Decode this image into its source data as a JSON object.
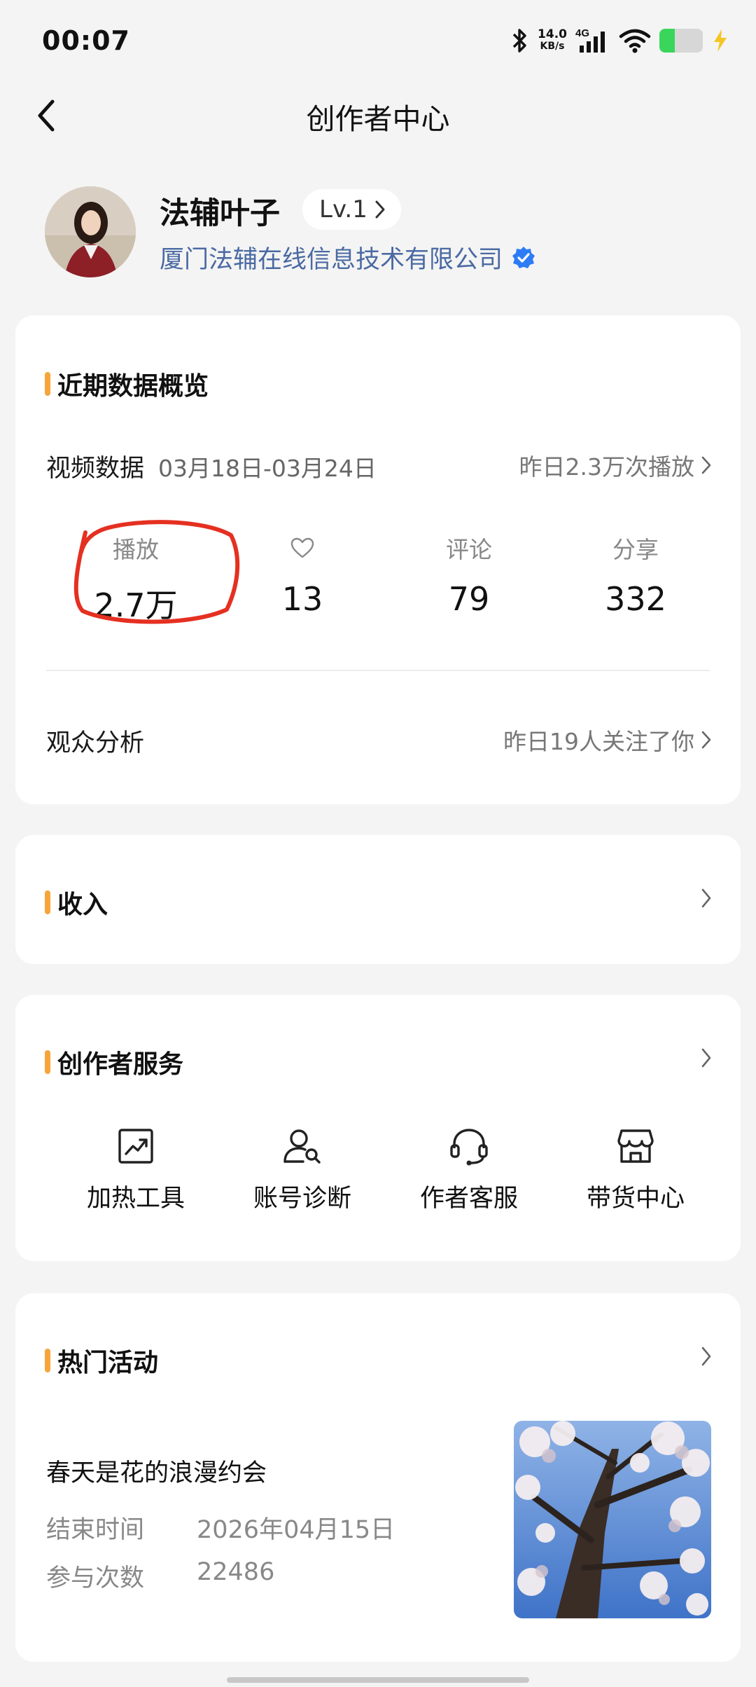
{
  "status_bar": {
    "time": "00:07",
    "net_speed_value": "14.0",
    "net_speed_unit": "KB/s",
    "network": "4G",
    "battery_fraction": 0.35,
    "icons": [
      "bluetooth-icon",
      "signal-icon",
      "wifi-icon",
      "battery-icon",
      "charging-icon"
    ]
  },
  "header": {
    "title": "创作者中心",
    "back_icon": "chevron-left-icon"
  },
  "profile": {
    "name": "法辅叶子",
    "level": "Lv.1",
    "company": "厦门法辅在线信息技术有限公司",
    "verified_icon": "verified-badge-icon"
  },
  "overview": {
    "title": "近期数据概览",
    "video_label": "视频数据",
    "date_range": "03月18日-03月24日",
    "yesterday_plays": "昨日2.3万次播放",
    "stats": [
      {
        "label": "播放",
        "value": "2.7万"
      },
      {
        "label": "",
        "icon": "heart-icon",
        "value": "13"
      },
      {
        "label": "评论",
        "value": "79"
      },
      {
        "label": "分享",
        "value": "332"
      }
    ],
    "audience_label": "观众分析",
    "audience_note": "昨日19人关注了你",
    "highlight_color": "#e53021"
  },
  "income": {
    "title": "收入"
  },
  "services": {
    "title": "创作者服务",
    "items": [
      {
        "label": "加热工具",
        "icon": "trend-chart-icon"
      },
      {
        "label": "账号诊断",
        "icon": "user-search-icon"
      },
      {
        "label": "作者客服",
        "icon": "headset-icon"
      },
      {
        "label": "带货中心",
        "icon": "store-icon"
      }
    ]
  },
  "activities": {
    "title": "热门活动",
    "item": {
      "name": "春天是花的浪漫约会",
      "end_label": "结束时间",
      "end_value": "2026年04月15日",
      "count_label": "参与次数",
      "count_value": "22486",
      "thumbnail": "cherry-blossom-image"
    }
  },
  "colors": {
    "accent": "#f6a53a",
    "link_blue": "#4a6aa3",
    "verified_blue": "#2d7cf6"
  }
}
